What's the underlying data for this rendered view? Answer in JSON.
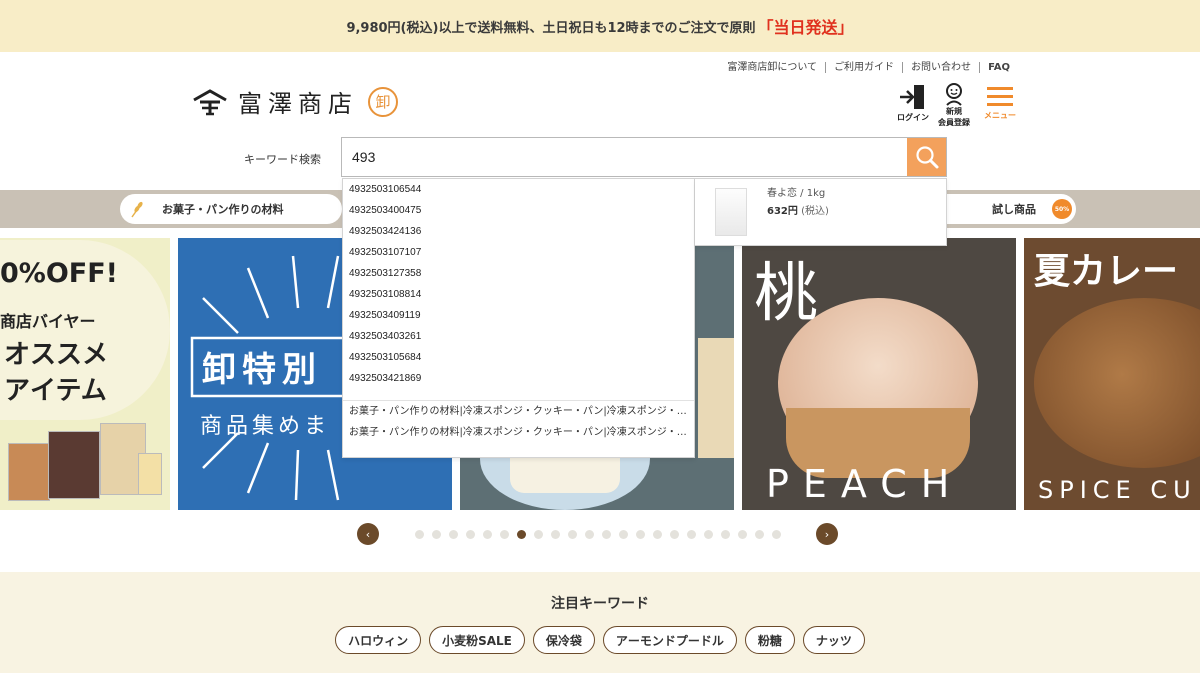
{
  "banner": {
    "text": "9,980円(税込)以上で送料無料、土日祝日も12時までのご注文で原則",
    "highlight": "「当日発送」"
  },
  "top_links": [
    "富澤商店卸について",
    "ご利用ガイド",
    "お問い合わせ",
    "FAQ"
  ],
  "logo": {
    "name": "富澤商店",
    "seal": "卸"
  },
  "header_icons": {
    "login": "ログイン",
    "register_line1": "新規",
    "register_line2": "会員登録",
    "menu": "メニュー"
  },
  "search": {
    "label": "キーワード検索",
    "value": "493"
  },
  "suggestions": {
    "numbers": [
      "4932503106544",
      "4932503400475",
      "4932503424136",
      "4932503107107",
      "4932503127358",
      "4932503108814",
      "4932503409119",
      "4932503403261",
      "4932503105684",
      "4932503421869"
    ],
    "categories": [
      "お菓子・パン作りの材料|冷凍スポンジ・クッキー・パン|冷凍スポンジ・クッキー・パン",
      "お菓子・パン作りの材料|冷凍スポンジ・クッキー・パン|冷凍スポンジ・クッキー・パン"
    ]
  },
  "product": {
    "name": "春よ恋 / 1kg",
    "price": "632円",
    "tax": "(税込)"
  },
  "categories": {
    "left": "お菓子・パン作りの材料",
    "right": "試し商品",
    "badge": "50%"
  },
  "slides": {
    "s1_title": "0%OFF!",
    "s1_line1": "商店バイヤー",
    "s1_line2": "オススメ",
    "s1_line3": "アイテム",
    "s2_line1": "卸特別",
    "s2_line2": "商品集めま",
    "s4_title": "桃",
    "s4_sub": "PEACH",
    "s5_title": "夏カレー",
    "s5_sub": "SPICE CU"
  },
  "carousel": {
    "dot_count": 22,
    "active_index": 6,
    "prev": "‹",
    "next": "›"
  },
  "featured": {
    "title": "注目キーワード",
    "keywords": [
      "ハロウィン",
      "小麦粉SALE",
      "保冷袋",
      "アーモンドプードル",
      "粉糖",
      "ナッツ"
    ]
  },
  "colors": {
    "accent": "#f3a15c",
    "brown": "#6b4a2a",
    "banner_bg": "#f8edc7",
    "highlight": "#e0311e"
  }
}
